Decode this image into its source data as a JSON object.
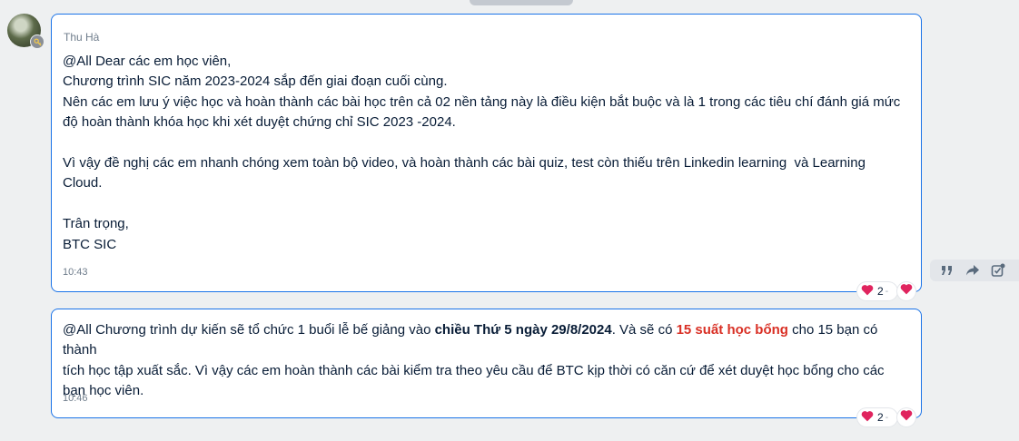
{
  "sender": {
    "name": "Thu Hà"
  },
  "message1": {
    "lines": [
      "@All Dear các em học viên,",
      "Chương trình SIC năm 2023-2024 sắp đến giai đoạn cuối cùng.",
      "Nên các em lưu ý việc học và hoàn thành các bài học trên cả 02 nền tảng này là điều kiện bắt buộc và là 1 trong các tiêu chí đánh giá mức",
      "độ hoàn thành khóa học khi xét duyệt chứng chỉ SIC 2023 -2024.",
      "",
      "Vì vậy đề nghị các em nhanh chóng xem toàn bộ video, và hoàn thành các bài quiz, test còn thiếu trên Linkedin learning  và Learning",
      "Cloud.",
      "",
      "Trân trọng,",
      "BTC SIC"
    ],
    "time": "10:43",
    "reaction_count": "2"
  },
  "message2": {
    "line1_part1": "@All Chương trình dự kiến sẽ tổ chức 1 buổi lễ bế giảng vào ",
    "line1_bold": "chiều Thứ 5 ngày 29/8/2024",
    "line1_part2": ". Và sẽ có ",
    "line1_red": "15 suất học bổng",
    "line1_part3": " cho 15 bạn có thành",
    "line2": "tích học tập xuất sắc. Vì vậy các em hoàn thành các bài kiểm tra theo yêu cầu để BTC kịp thời có căn cứ để xét duyệt học bổng cho các",
    "line3": "bạn học viên.",
    "time": "10:46",
    "reaction_count": "2"
  },
  "colors": {
    "bubble_border": "#1a73e8",
    "highlight_red": "#d93025",
    "heart": "#e0245e",
    "background": "#eef0f1"
  },
  "icons": {
    "quote": "quote-icon",
    "forward": "forward-icon",
    "task": "task-icon",
    "heart": "heart-icon",
    "key": "key-icon"
  }
}
